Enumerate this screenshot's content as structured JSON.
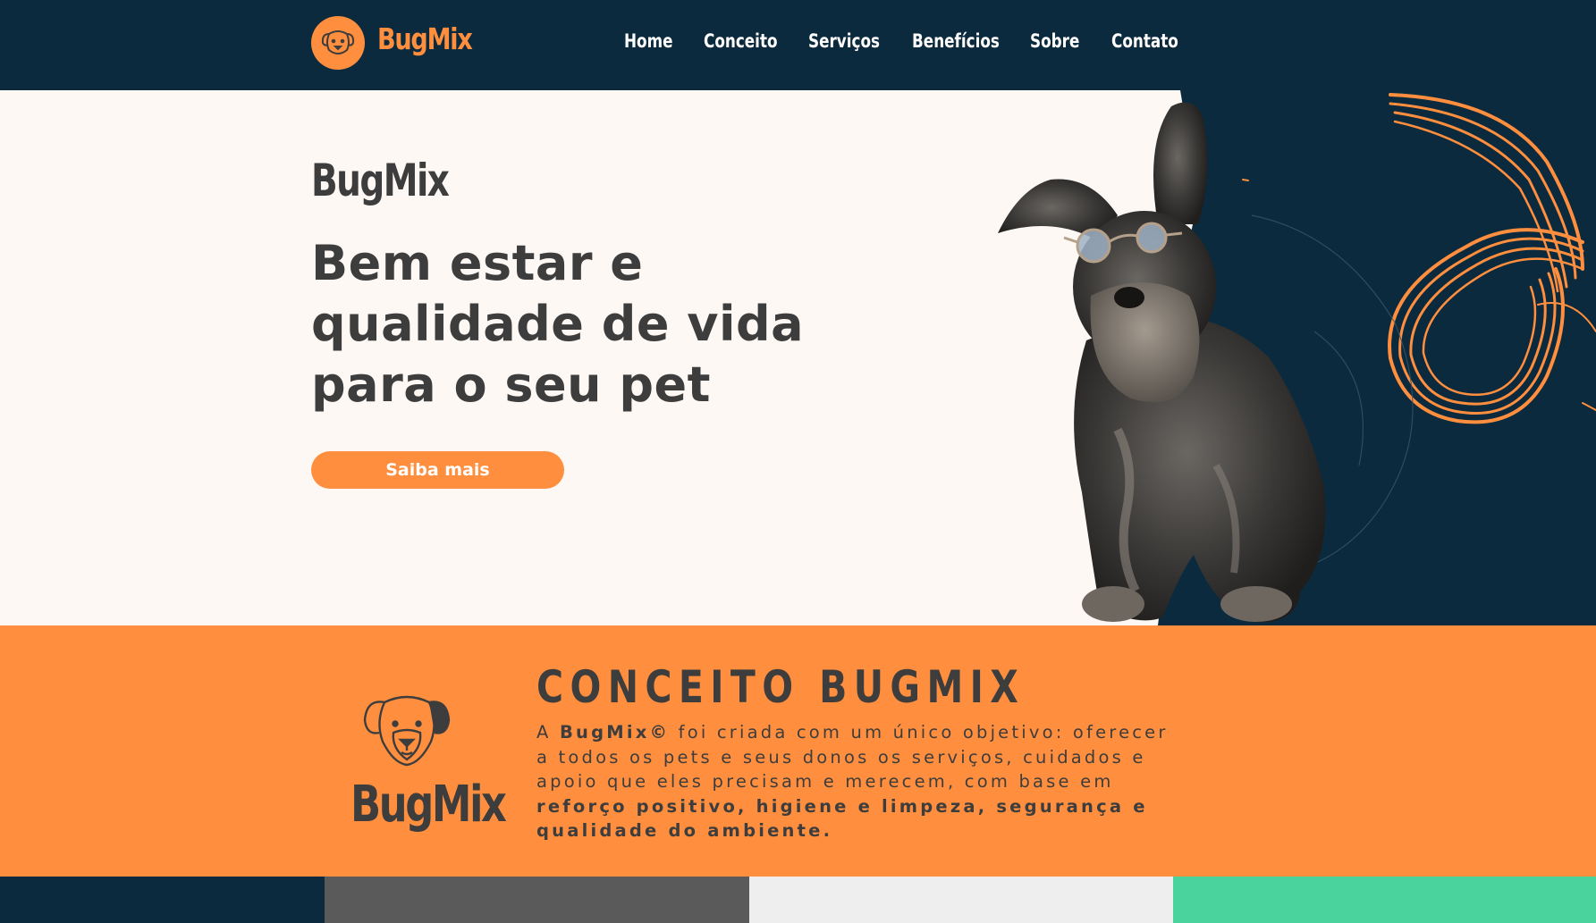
{
  "header": {
    "brand": "BugMix",
    "nav": [
      "Home",
      "Conceito",
      "Serviços",
      "Benefícios",
      "Sobre",
      "Contato"
    ]
  },
  "hero": {
    "brand": "BugMix",
    "title_line1": "Bem estar e",
    "title_line2": "qualidade de vida",
    "title_line3": "para o seu pet",
    "cta_label": "Saiba mais"
  },
  "concept": {
    "logo_text": "BugMix",
    "title": "CONCEITO BUGMIX",
    "text_1": "A ",
    "text_2": "BugMix©",
    "text_3": " foi criada com um único objetivo: oferecer a todos os pets e seus donos os serviços, cuidados e apoio que eles precisam e merecem, com base em ",
    "text_4": "reforço positivo, higiene e limpeza, segurança e qualidade do ambiente."
  },
  "colors": {
    "navy": "#0b2a3d",
    "orange": "#ff8f3e",
    "dark_text": "#3d3d3d",
    "cream": "#fdf8f4",
    "strip_gray": "#5a5a5a",
    "strip_light": "#eeeeee",
    "strip_green": "#4bd39e"
  },
  "icons": {
    "logo": "dog-face-icon",
    "hero_image": "schnauzer-dog-with-glasses-image"
  }
}
